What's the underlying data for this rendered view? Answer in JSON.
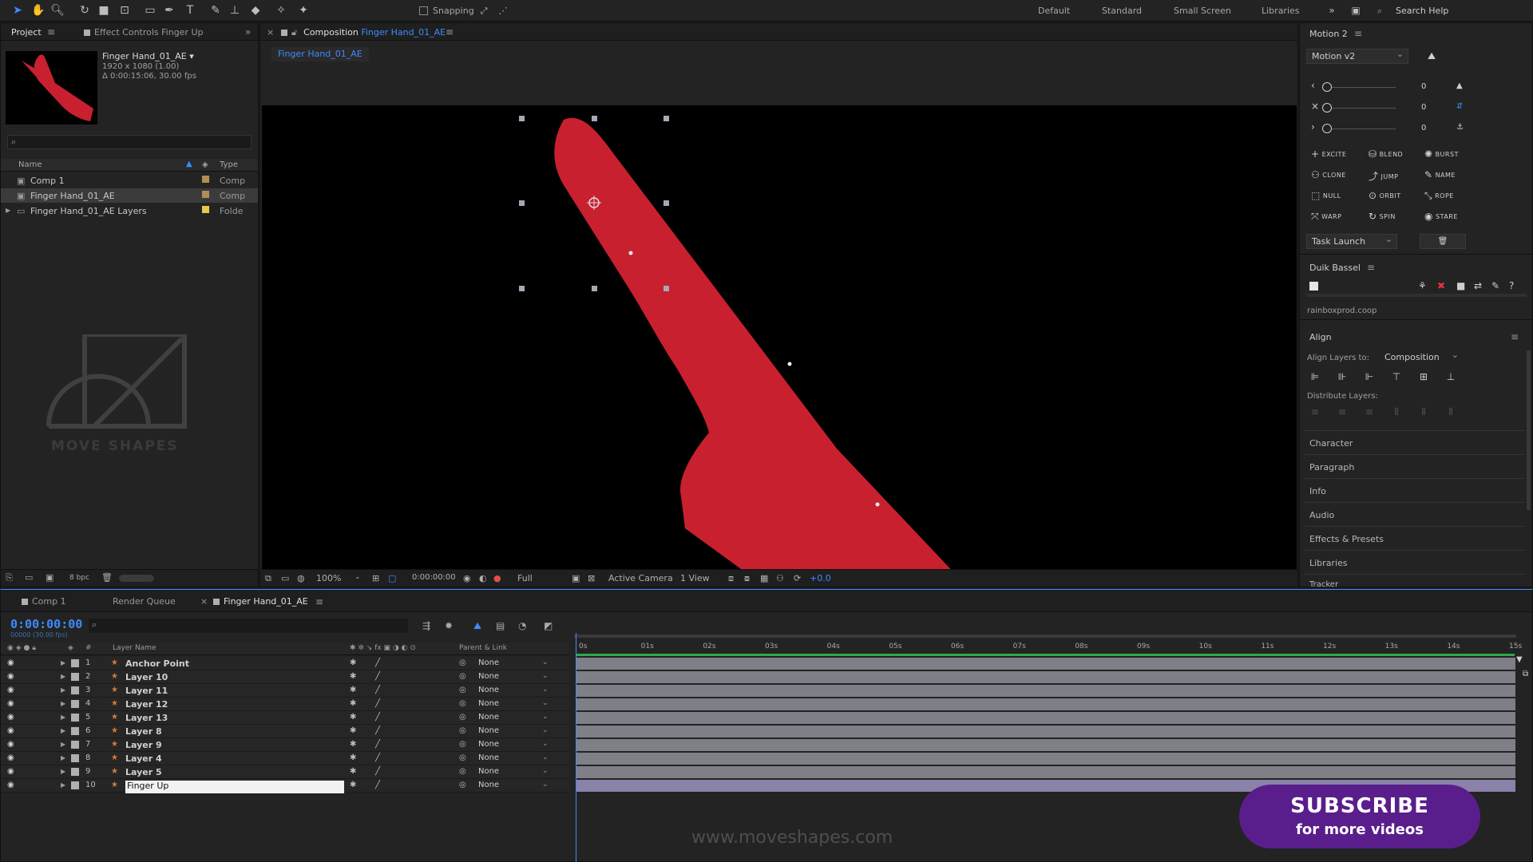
{
  "toolbar": {
    "snapping_label": "Snapping",
    "workspaces": [
      "Default",
      "Standard",
      "Small Screen",
      "Libraries"
    ],
    "search_placeholder": "Search Help"
  },
  "project": {
    "tab_project": "Project",
    "tab_effect_controls": "Effect Controls Finger Up",
    "comp_name": "Finger Hand_01_AE",
    "comp_dims": "1920 x 1080 (1.00)",
    "comp_duration": "Δ 0:00:15:06, 30.00 fps",
    "col_name": "Name",
    "col_type": "Type",
    "items": [
      {
        "name": "Comp 1",
        "type": "Comp",
        "color": "#b38b54"
      },
      {
        "name": "Finger Hand_01_AE",
        "type": "Comp",
        "color": "#b38b54"
      },
      {
        "name": "Finger Hand_01_AE Layers",
        "type": "Folde",
        "color": "#e8c84a"
      }
    ],
    "watermark_text": "MOVE SHAPES",
    "bpc": "8 bpc"
  },
  "composition": {
    "tab_prefix": "Composition",
    "tab_name": "Finger Hand_01_AE",
    "sub_tab": "Finger Hand_01_AE",
    "zoom": "100%",
    "time": "0:00:00:00",
    "resolution": "Full",
    "camera": "Active Camera",
    "views": "1 View",
    "exposure": "+0.0"
  },
  "motion": {
    "title": "Motion 2",
    "version": "Motion v2",
    "slider_values": [
      "0",
      "0",
      "0"
    ],
    "buttons": [
      "EXCITE",
      "BLEND",
      "BURST",
      "CLONE",
      "JUMP",
      "NAME",
      "NULL",
      "ORBIT",
      "ROPE",
      "WARP",
      "SPIN",
      "STARE"
    ],
    "task": "Task Launch"
  },
  "duik": {
    "title": "Duik Bassel",
    "site": "rainboxprod.coop"
  },
  "align": {
    "title": "Align",
    "align_to_label": "Align Layers to:",
    "align_to_value": "Composition",
    "distribute_label": "Distribute Layers:"
  },
  "collapsed_panels": [
    "Character",
    "Paragraph",
    "Info",
    "Audio",
    "Effects & Presets",
    "Libraries",
    "Tracker"
  ],
  "timeline": {
    "tabs": [
      "Comp 1",
      "Render Queue",
      "Finger Hand_01_AE"
    ],
    "timecode": "0:00:00:00",
    "timecode_sub": "00000 (30.00 fps)",
    "col_layer_name": "Layer Name",
    "col_parent": "Parent & Link",
    "ruler_ticks": [
      "0s",
      "01s",
      "02s",
      "03s",
      "04s",
      "05s",
      "06s",
      "07s",
      "08s",
      "09s",
      "10s",
      "11s",
      "12s",
      "13s",
      "14s",
      "15s"
    ],
    "layers": [
      {
        "num": "1",
        "name": "Anchor Point",
        "parent": "None"
      },
      {
        "num": "2",
        "name": "Layer 10",
        "parent": "None"
      },
      {
        "num": "3",
        "name": "Layer 11",
        "parent": "None"
      },
      {
        "num": "4",
        "name": "Layer 12",
        "parent": "None"
      },
      {
        "num": "5",
        "name": "Layer 13",
        "parent": "None"
      },
      {
        "num": "6",
        "name": "Layer 8",
        "parent": "None"
      },
      {
        "num": "7",
        "name": "Layer 9",
        "parent": "None"
      },
      {
        "num": "8",
        "name": "Layer 4",
        "parent": "None"
      },
      {
        "num": "9",
        "name": "Layer 5",
        "parent": "None"
      },
      {
        "num": "10",
        "name": "Finger Up",
        "parent": "None"
      }
    ]
  },
  "overlay": {
    "subscribe_1": "SUBSCRIBE",
    "subscribe_2": "for more videos",
    "site_url": "www.moveshapes.com"
  },
  "colors": {
    "accent": "#3d8cff",
    "finger": "#c8202f",
    "subscribe_bg": "#5a1e8c"
  }
}
